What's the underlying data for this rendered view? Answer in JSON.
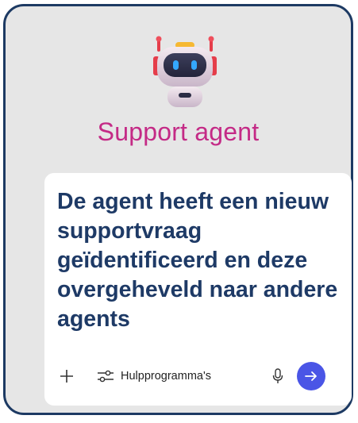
{
  "agent": {
    "name": "Support agent",
    "avatar_icon": "robot-icon"
  },
  "chat": {
    "message": "De agent heeft een nieuw supportvraag geïdentificeerd en deze overgeheveld naar andere agents"
  },
  "toolbar": {
    "add_icon": "plus-icon",
    "tools_icon": "sliders-icon",
    "tools_label": "Hulpprogramma's",
    "mic_icon": "microphone-icon",
    "send_icon": "arrow-right-icon"
  },
  "colors": {
    "title": "#c42a86",
    "message": "#1e3a66",
    "border": "#1d3a63",
    "card_background": "#e6e6e6",
    "send_button": "#4a55e6"
  }
}
